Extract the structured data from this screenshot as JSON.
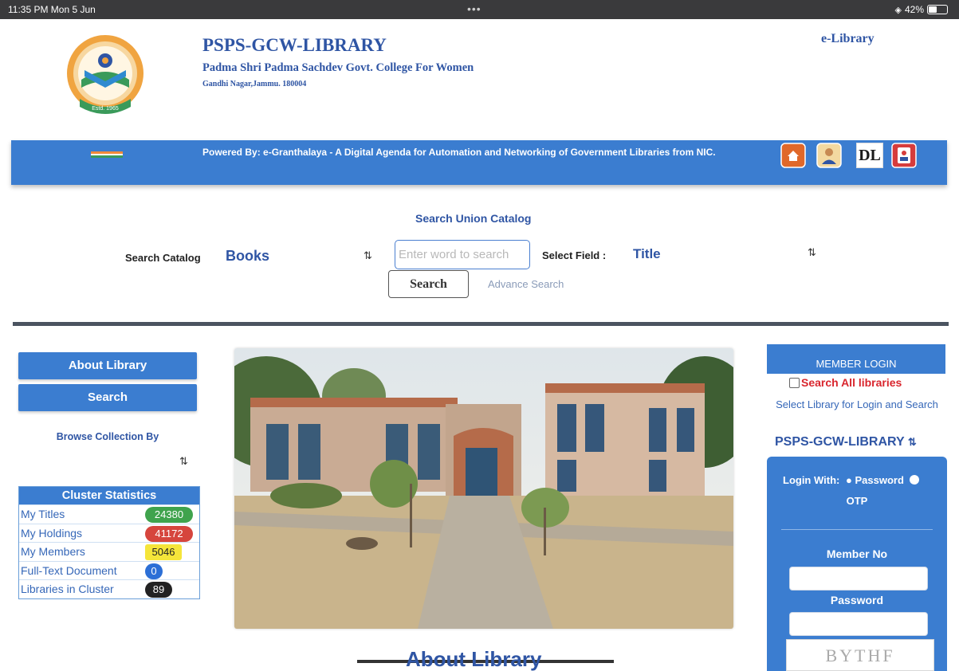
{
  "status_bar": {
    "time": "11:35 PM  Mon 5 Jun",
    "dots": "•••",
    "battery": "42%",
    "battery_level": 0.42
  },
  "header": {
    "title": "PSPS-GCW-LIBRARY",
    "subtitle": "Padma Shri Padma Sachdev Govt. College For Women",
    "address": "Gandhi Nagar,Jammu. 180004",
    "elibrary_link": "e-Library",
    "logo_text": "Estd. 1965"
  },
  "banner": {
    "text": "Powered By: e-Granthalaya - A Digital Agenda for Automation and Networking of Government Libraries from NIC.",
    "icons": [
      "home-icon",
      "user-icon",
      "dl-icon",
      "member-card-icon"
    ],
    "dl_text": "DL"
  },
  "search": {
    "heading": "Search Union Catalog",
    "catalog_label": "Search Catalog",
    "catalog_value": "Books",
    "input_placeholder": "Enter word to search",
    "field_label": "Select Field :",
    "field_value": "Title",
    "search_button": "Search",
    "advance_link": "Advance Search"
  },
  "left": {
    "about_button": "About Library",
    "search_button": "Search",
    "browse_label": "Browse Collection By",
    "cluster": {
      "heading": "Cluster Statistics",
      "rows": [
        {
          "label": "My Titles",
          "value": "24380",
          "color": "#3fa34d"
        },
        {
          "label": "My Holdings",
          "value": "41172",
          "color": "#d6453d"
        },
        {
          "label": "My Members",
          "value": "5046",
          "color": "#f5e53a"
        },
        {
          "label": "Full-Text Document",
          "value": "0",
          "color": "#2c6fd6"
        },
        {
          "label": "Libraries in Cluster",
          "value": "89",
          "color": "#222222"
        }
      ]
    }
  },
  "main": {
    "about_heading": "About Library"
  },
  "right": {
    "member_login": "MEMBER LOGIN",
    "search_all": "Search All libraries",
    "select_library_text": "Select Library for Login and Search",
    "library_value": "PSPS-GCW-LIBRARY",
    "login_with_label": "Login With:",
    "password_option": "Password",
    "otp_option": "OTP",
    "member_no_label": "Member No",
    "password_label": "Password",
    "captcha": "BYTHF"
  },
  "colors": {
    "brand_blue": "#3b7dd0",
    "title_blue": "#2f55a4",
    "alert_red": "#d9262e"
  }
}
